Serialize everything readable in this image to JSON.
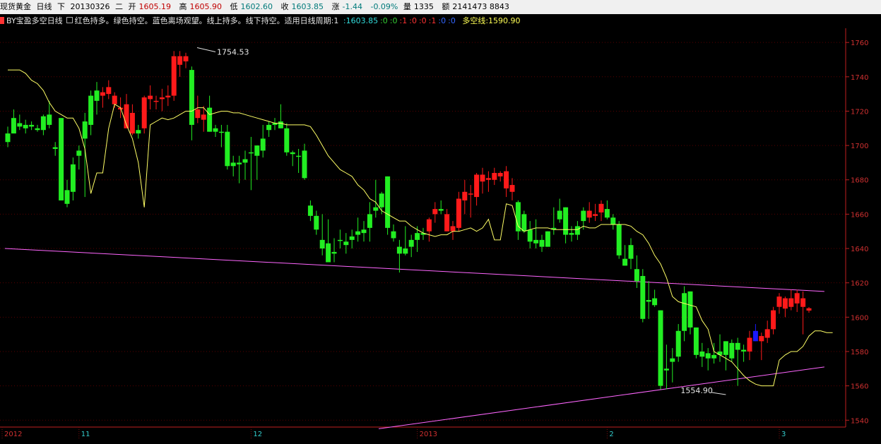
{
  "header": {
    "symbol": "现货黄金",
    "period": "日线",
    "direction": "下",
    "date": "20130326",
    "weekday": "二",
    "open_label": "开",
    "open": "1605.19",
    "high_label": "高",
    "high": "1605.90",
    "low_label": "低",
    "low": "1602.60",
    "close_label": "收",
    "close": "1603.85",
    "change_label": "涨",
    "change": "-1.44",
    "change_pct": "-0.09%",
    "volume_label": "量",
    "volume": "1335",
    "amount_label": "额",
    "amount": "2141473 8843"
  },
  "indicator": {
    "name": "BY宝盈多空日线",
    "desc": "红色持多。绿色持空。蓝色离场观望。线上持多。线下持空。适用日线周期:1",
    "values": [
      {
        "text": ":1603.85",
        "color": "cyan"
      },
      {
        "text": ":0",
        "color": "green"
      },
      {
        "text": ":0",
        "color": "green"
      },
      {
        "text": ":1",
        "color": "red"
      },
      {
        "text": ":0",
        "color": "red"
      },
      {
        "text": ":0",
        "color": "red"
      },
      {
        "text": ":1",
        "color": "red"
      },
      {
        "text": ":0",
        "color": "blue"
      },
      {
        "text": ":0",
        "color": "blue"
      }
    ],
    "line_label": "多空线:1590.90"
  },
  "colors": {
    "up": "#ff1a1a",
    "down": "#22ee22",
    "neutral": "#1a1aff",
    "ma": "#ffff66",
    "trendline": "#ff66ff",
    "grid": "#5a0000",
    "axis": "#c02020",
    "axis_text": "#d03030",
    "time_text": "#33cccc"
  },
  "chart_data": {
    "type": "candlestick",
    "y_ticks": [
      1540,
      1560,
      1580,
      1600,
      1620,
      1640,
      1660,
      1680,
      1700,
      1720,
      1740,
      1760
    ],
    "time_labels": [
      {
        "label": "2012",
        "index": 0
      },
      {
        "label": "11",
        "index": 12
      },
      {
        "label": "12",
        "index": 41
      },
      {
        "label": "2013",
        "index": 69
      },
      {
        "label": "2",
        "index": 101
      },
      {
        "label": "3",
        "index": 130
      }
    ],
    "annotations": [
      {
        "text": "1754.53",
        "index": 35,
        "value": 1754.53
      },
      {
        "text": "1554.90",
        "index": 121,
        "value": 1554.9
      }
    ],
    "candles": [
      {
        "o": 1702,
        "h": 1711,
        "l": 1699,
        "c": 1707,
        "k": "down"
      },
      {
        "o": 1716,
        "h": 1721,
        "l": 1707,
        "c": 1707,
        "k": "down"
      },
      {
        "o": 1713,
        "h": 1718,
        "l": 1709,
        "c": 1711,
        "k": "down"
      },
      {
        "o": 1712,
        "h": 1715,
        "l": 1707,
        "c": 1710,
        "k": "down"
      },
      {
        "o": 1711,
        "h": 1714,
        "l": 1709,
        "c": 1712,
        "k": "down"
      },
      {
        "o": 1710,
        "h": 1712,
        "l": 1708,
        "c": 1709,
        "k": "down"
      },
      {
        "o": 1709,
        "h": 1718,
        "l": 1706,
        "c": 1717,
        "k": "down"
      },
      {
        "o": 1718,
        "h": 1726,
        "l": 1710,
        "c": 1712,
        "k": "down"
      },
      {
        "o": 1698,
        "h": 1702,
        "l": 1694,
        "c": 1699,
        "k": "down"
      },
      {
        "o": 1716,
        "h": 1716,
        "l": 1671,
        "c": 1668,
        "k": "down"
      },
      {
        "o": 1666,
        "h": 1680,
        "l": 1664,
        "c": 1674,
        "k": "down"
      },
      {
        "o": 1689,
        "h": 1693,
        "l": 1668,
        "c": 1673,
        "k": "down"
      },
      {
        "o": 1694,
        "h": 1700,
        "l": 1686,
        "c": 1697,
        "k": "down"
      },
      {
        "o": 1704,
        "h": 1719,
        "l": 1670,
        "c": 1714,
        "k": "down"
      },
      {
        "o": 1712,
        "h": 1732,
        "l": 1706,
        "c": 1729,
        "k": "down"
      },
      {
        "o": 1726,
        "h": 1737,
        "l": 1718,
        "c": 1732,
        "k": "down"
      },
      {
        "o": 1729,
        "h": 1734,
        "l": 1722,
        "c": 1731,
        "k": "up"
      },
      {
        "o": 1734,
        "h": 1738,
        "l": 1727,
        "c": 1730,
        "k": "up"
      },
      {
        "o": 1729,
        "h": 1731,
        "l": 1722,
        "c": 1724,
        "k": "up"
      },
      {
        "o": 1721,
        "h": 1728,
        "l": 1716,
        "c": 1722,
        "k": "up"
      },
      {
        "o": 1724,
        "h": 1730,
        "l": 1710,
        "c": 1710,
        "k": "up"
      },
      {
        "o": 1719,
        "h": 1724,
        "l": 1706,
        "c": 1707,
        "k": "up"
      },
      {
        "o": 1707,
        "h": 1712,
        "l": 1704,
        "c": 1709,
        "k": "down"
      },
      {
        "o": 1710,
        "h": 1729,
        "l": 1707,
        "c": 1728,
        "k": "up"
      },
      {
        "o": 1729,
        "h": 1735,
        "l": 1721,
        "c": 1727,
        "k": "up"
      },
      {
        "o": 1726,
        "h": 1729,
        "l": 1721,
        "c": 1726,
        "k": "up"
      },
      {
        "o": 1727,
        "h": 1733,
        "l": 1720,
        "c": 1728,
        "k": "up"
      },
      {
        "o": 1728,
        "h": 1735,
        "l": 1723,
        "c": 1729,
        "k": "up"
      },
      {
        "o": 1729,
        "h": 1755,
        "l": 1726,
        "c": 1752,
        "k": "up"
      },
      {
        "o": 1752,
        "h": 1755,
        "l": 1740,
        "c": 1747,
        "k": "up"
      },
      {
        "o": 1752,
        "h": 1754,
        "l": 1745,
        "c": 1749,
        "k": "up"
      },
      {
        "o": 1744,
        "h": 1746,
        "l": 1703,
        "c": 1712,
        "k": "down"
      },
      {
        "o": 1721,
        "h": 1729,
        "l": 1713,
        "c": 1716,
        "k": "up"
      },
      {
        "o": 1718,
        "h": 1723,
        "l": 1708,
        "c": 1715,
        "k": "up"
      },
      {
        "o": 1722,
        "h": 1729,
        "l": 1708,
        "c": 1708,
        "k": "down"
      },
      {
        "o": 1710,
        "h": 1712,
        "l": 1705,
        "c": 1708,
        "k": "down"
      },
      {
        "o": 1708,
        "h": 1712,
        "l": 1699,
        "c": 1708,
        "k": "down"
      },
      {
        "o": 1708,
        "h": 1712,
        "l": 1686,
        "c": 1688,
        "k": "down"
      },
      {
        "o": 1690,
        "h": 1694,
        "l": 1682,
        "c": 1688,
        "k": "down"
      },
      {
        "o": 1690,
        "h": 1694,
        "l": 1678,
        "c": 1689,
        "k": "down"
      },
      {
        "o": 1690,
        "h": 1697,
        "l": 1680,
        "c": 1692,
        "k": "down"
      },
      {
        "o": 1696,
        "h": 1705,
        "l": 1674,
        "c": 1696,
        "k": "down"
      },
      {
        "o": 1694,
        "h": 1700,
        "l": 1680,
        "c": 1700,
        "k": "down"
      },
      {
        "o": 1697,
        "h": 1712,
        "l": 1693,
        "c": 1704,
        "k": "down"
      },
      {
        "o": 1709,
        "h": 1714,
        "l": 1705,
        "c": 1712,
        "k": "down"
      },
      {
        "o": 1712,
        "h": 1716,
        "l": 1709,
        "c": 1713,
        "k": "down"
      },
      {
        "o": 1714,
        "h": 1724,
        "l": 1711,
        "c": 1710,
        "k": "down"
      },
      {
        "o": 1710,
        "h": 1713,
        "l": 1694,
        "c": 1696,
        "k": "down"
      },
      {
        "o": 1695,
        "h": 1697,
        "l": 1688,
        "c": 1696,
        "k": "down"
      },
      {
        "o": 1694,
        "h": 1698,
        "l": 1684,
        "c": 1694,
        "k": "down"
      },
      {
        "o": 1697,
        "h": 1701,
        "l": 1680,
        "c": 1681,
        "k": "down"
      },
      {
        "o": 1665,
        "h": 1668,
        "l": 1656,
        "c": 1659,
        "k": "down"
      },
      {
        "o": 1659,
        "h": 1662,
        "l": 1648,
        "c": 1651,
        "k": "down"
      },
      {
        "o": 1645,
        "h": 1660,
        "l": 1636,
        "c": 1640,
        "k": "down"
      },
      {
        "o": 1632,
        "h": 1657,
        "l": 1637,
        "c": 1643,
        "k": "down"
      },
      {
        "o": 1638,
        "h": 1646,
        "l": 1632,
        "c": 1637,
        "k": "down"
      },
      {
        "o": 1645,
        "h": 1651,
        "l": 1640,
        "c": 1645,
        "k": "down"
      },
      {
        "o": 1642,
        "h": 1649,
        "l": 1637,
        "c": 1644,
        "k": "down"
      },
      {
        "o": 1645,
        "h": 1651,
        "l": 1640,
        "c": 1647,
        "k": "down"
      },
      {
        "o": 1650,
        "h": 1658,
        "l": 1644,
        "c": 1648,
        "k": "down"
      },
      {
        "o": 1651,
        "h": 1656,
        "l": 1644,
        "c": 1649,
        "k": "down"
      },
      {
        "o": 1652,
        "h": 1667,
        "l": 1644,
        "c": 1660,
        "k": "down"
      },
      {
        "o": 1664,
        "h": 1680,
        "l": 1658,
        "c": 1662,
        "k": "down"
      },
      {
        "o": 1664,
        "h": 1673,
        "l": 1660,
        "c": 1672,
        "k": "down"
      },
      {
        "o": 1682,
        "h": 1682,
        "l": 1648,
        "c": 1652,
        "k": "down"
      },
      {
        "o": 1650,
        "h": 1654,
        "l": 1644,
        "c": 1646,
        "k": "down"
      },
      {
        "o": 1641,
        "h": 1645,
        "l": 1626,
        "c": 1637,
        "k": "down"
      },
      {
        "o": 1637,
        "h": 1653,
        "l": 1636,
        "c": 1640,
        "k": "down"
      },
      {
        "o": 1641,
        "h": 1648,
        "l": 1635,
        "c": 1645,
        "k": "down"
      },
      {
        "o": 1645,
        "h": 1653,
        "l": 1638,
        "c": 1649,
        "k": "down"
      },
      {
        "o": 1649,
        "h": 1652,
        "l": 1645,
        "c": 1648,
        "k": "down"
      },
      {
        "o": 1650,
        "h": 1658,
        "l": 1644,
        "c": 1657,
        "k": "up"
      },
      {
        "o": 1660,
        "h": 1667,
        "l": 1655,
        "c": 1663,
        "k": "up"
      },
      {
        "o": 1663,
        "h": 1668,
        "l": 1660,
        "c": 1662,
        "k": "down"
      },
      {
        "o": 1660,
        "h": 1663,
        "l": 1650,
        "c": 1650,
        "k": "up"
      },
      {
        "o": 1650,
        "h": 1656,
        "l": 1645,
        "c": 1653,
        "k": "up"
      },
      {
        "o": 1652,
        "h": 1673,
        "l": 1650,
        "c": 1669,
        "k": "up"
      },
      {
        "o": 1668,
        "h": 1680,
        "l": 1660,
        "c": 1673,
        "k": "up"
      },
      {
        "o": 1672,
        "h": 1677,
        "l": 1658,
        "c": 1672,
        "k": "up"
      },
      {
        "o": 1670,
        "h": 1684,
        "l": 1665,
        "c": 1683,
        "k": "up"
      },
      {
        "o": 1683,
        "h": 1687,
        "l": 1672,
        "c": 1679,
        "k": "up"
      },
      {
        "o": 1681,
        "h": 1685,
        "l": 1673,
        "c": 1680,
        "k": "up"
      },
      {
        "o": 1684,
        "h": 1687,
        "l": 1677,
        "c": 1680,
        "k": "up"
      },
      {
        "o": 1682,
        "h": 1685,
        "l": 1679,
        "c": 1684,
        "k": "up"
      },
      {
        "o": 1685,
        "h": 1688,
        "l": 1670,
        "c": 1675,
        "k": "up"
      },
      {
        "o": 1677,
        "h": 1681,
        "l": 1668,
        "c": 1673,
        "k": "up"
      },
      {
        "o": 1667,
        "h": 1668,
        "l": 1645,
        "c": 1650,
        "k": "down"
      },
      {
        "o": 1660,
        "h": 1662,
        "l": 1649,
        "c": 1650,
        "k": "down"
      },
      {
        "o": 1651,
        "h": 1656,
        "l": 1640,
        "c": 1644,
        "k": "down"
      },
      {
        "o": 1645,
        "h": 1657,
        "l": 1640,
        "c": 1643,
        "k": "down"
      },
      {
        "o": 1645,
        "h": 1648,
        "l": 1638,
        "c": 1641,
        "k": "down"
      },
      {
        "o": 1641,
        "h": 1650,
        "l": 1641,
        "c": 1650,
        "k": "down"
      },
      {
        "o": 1651,
        "h": 1664,
        "l": 1648,
        "c": 1652,
        "k": "down"
      },
      {
        "o": 1657,
        "h": 1669,
        "l": 1655,
        "c": 1662,
        "k": "down"
      },
      {
        "o": 1664,
        "h": 1662,
        "l": 1643,
        "c": 1648,
        "k": "down"
      },
      {
        "o": 1648,
        "h": 1653,
        "l": 1644,
        "c": 1649,
        "k": "down"
      },
      {
        "o": 1653,
        "h": 1656,
        "l": 1645,
        "c": 1648,
        "k": "down"
      },
      {
        "o": 1656,
        "h": 1664,
        "l": 1651,
        "c": 1662,
        "k": "down"
      },
      {
        "o": 1662,
        "h": 1667,
        "l": 1655,
        "c": 1658,
        "k": "up"
      },
      {
        "o": 1660,
        "h": 1666,
        "l": 1656,
        "c": 1659,
        "k": "up"
      },
      {
        "o": 1661,
        "h": 1668,
        "l": 1656,
        "c": 1666,
        "k": "up"
      },
      {
        "o": 1663,
        "h": 1668,
        "l": 1657,
        "c": 1658,
        "k": "down"
      },
      {
        "o": 1658,
        "h": 1660,
        "l": 1651,
        "c": 1654,
        "k": "down"
      },
      {
        "o": 1654,
        "h": 1656,
        "l": 1634,
        "c": 1636,
        "k": "down"
      },
      {
        "o": 1634,
        "h": 1642,
        "l": 1630,
        "c": 1630,
        "k": "down"
      },
      {
        "o": 1642,
        "h": 1646,
        "l": 1628,
        "c": 1634,
        "k": "down"
      },
      {
        "o": 1628,
        "h": 1636,
        "l": 1617,
        "c": 1621,
        "k": "down"
      },
      {
        "o": 1624,
        "h": 1628,
        "l": 1597,
        "c": 1599,
        "k": "down"
      },
      {
        "o": 1609,
        "h": 1621,
        "l": 1599,
        "c": 1610,
        "k": "down"
      },
      {
        "o": 1611,
        "h": 1616,
        "l": 1606,
        "c": 1607,
        "k": "down"
      },
      {
        "o": 1604,
        "h": 1604,
        "l": 1558,
        "c": 1560,
        "k": "down"
      },
      {
        "o": 1570,
        "h": 1584,
        "l": 1558,
        "c": 1569,
        "k": "down"
      },
      {
        "o": 1576,
        "h": 1582,
        "l": 1562,
        "c": 1574,
        "k": "down"
      },
      {
        "o": 1577,
        "h": 1596,
        "l": 1574,
        "c": 1592,
        "k": "down"
      },
      {
        "o": 1592,
        "h": 1618,
        "l": 1586,
        "c": 1614,
        "k": "down"
      },
      {
        "o": 1615,
        "h": 1613,
        "l": 1590,
        "c": 1594,
        "k": "down"
      },
      {
        "o": 1594,
        "h": 1594,
        "l": 1576,
        "c": 1578,
        "k": "down"
      },
      {
        "o": 1580,
        "h": 1585,
        "l": 1571,
        "c": 1577,
        "k": "down"
      },
      {
        "o": 1579,
        "h": 1582,
        "l": 1569,
        "c": 1576,
        "k": "down"
      },
      {
        "o": 1576,
        "h": 1585,
        "l": 1573,
        "c": 1578,
        "k": "down"
      },
      {
        "o": 1578,
        "h": 1590,
        "l": 1574,
        "c": 1580,
        "k": "down"
      },
      {
        "o": 1586,
        "h": 1586,
        "l": 1569,
        "c": 1578,
        "k": "down"
      },
      {
        "o": 1576,
        "h": 1587,
        "l": 1574,
        "c": 1585,
        "k": "down"
      },
      {
        "o": 1585,
        "h": 1588,
        "l": 1560,
        "c": 1581,
        "k": "down"
      },
      {
        "o": 1581,
        "h": 1584,
        "l": 1574,
        "c": 1580,
        "k": "down"
      },
      {
        "o": 1580,
        "h": 1592,
        "l": 1575,
        "c": 1588,
        "k": "up"
      },
      {
        "o": 1592,
        "h": 1596,
        "l": 1586,
        "c": 1586,
        "k": "neutral"
      },
      {
        "o": 1586,
        "h": 1591,
        "l": 1575,
        "c": 1589,
        "k": "up"
      },
      {
        "o": 1588,
        "h": 1598,
        "l": 1585,
        "c": 1593,
        "k": "up"
      },
      {
        "o": 1593,
        "h": 1606,
        "l": 1590,
        "c": 1604,
        "k": "up"
      },
      {
        "o": 1606,
        "h": 1614,
        "l": 1602,
        "c": 1612,
        "k": "up"
      },
      {
        "o": 1605,
        "h": 1612,
        "l": 1600,
        "c": 1611,
        "k": "up"
      },
      {
        "o": 1611,
        "h": 1616,
        "l": 1604,
        "c": 1606,
        "k": "up"
      },
      {
        "o": 1614,
        "h": 1616,
        "l": 1603,
        "c": 1608,
        "k": "up"
      },
      {
        "o": 1611,
        "h": 1615,
        "l": 1590,
        "c": 1606,
        "k": "up"
      },
      {
        "o": 1605.19,
        "h": 1605.9,
        "l": 1602.6,
        "c": 1603.85,
        "k": "up"
      }
    ],
    "long_short_line": [
      1744,
      1744,
      1744,
      1742,
      1738,
      1736,
      1732,
      1725,
      1720,
      1718,
      1716,
      1716,
      1710,
      1698,
      1672,
      1684,
      1684,
      1710,
      1724,
      1722,
      1712,
      1704,
      1690,
      1664,
      1712,
      1714,
      1716,
      1715,
      1716,
      1718,
      1720,
      1720,
      1722,
      1722,
      1718,
      1719,
      1720,
      1720,
      1719,
      1719,
      1718,
      1717,
      1716,
      1715,
      1714,
      1713,
      1713,
      1712,
      1712,
      1712,
      1712,
      1711,
      1706,
      1700,
      1694,
      1690,
      1686,
      1684,
      1682,
      1677,
      1674,
      1669,
      1667,
      1662,
      1660,
      1658,
      1656,
      1656,
      1653,
      1651,
      1649,
      1648,
      1647,
      1648,
      1648,
      1650,
      1650,
      1651,
      1652,
      1650,
      1652,
      1657,
      1645,
      1645,
      1666,
      1665,
      1653,
      1650,
      1651,
      1652,
      1652,
      1652,
      1651,
      1651,
      1651,
      1651,
      1651,
      1653,
      1652,
      1652,
      1654,
      1654,
      1654,
      1654,
      1654,
      1653,
      1650,
      1648,
      1643,
      1636,
      1631,
      1623,
      1612,
      1609,
      1608,
      1607,
      1606,
      1598,
      1593,
      1580,
      1578,
      1576,
      1574,
      1570,
      1566,
      1563,
      1561,
      1560,
      1560,
      1560,
      1575,
      1578,
      1580,
      1580,
      1583,
      1589,
      1592,
      1592,
      1591,
      1591
    ],
    "trendlines": [
      {
        "name": "upper",
        "x0_index": -0.5,
        "v0": 1640,
        "x1_index": 137.6,
        "v1": 1615
      },
      {
        "name": "lower",
        "x0_index": 62.5,
        "v0": 1535,
        "x1_index": 137.6,
        "v1": 1571
      }
    ]
  }
}
